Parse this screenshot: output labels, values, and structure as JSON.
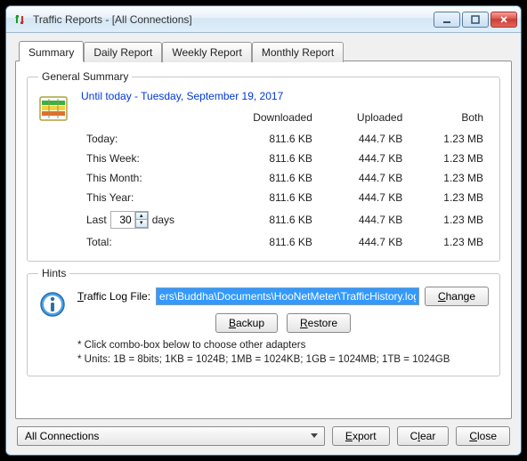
{
  "window": {
    "title": "Traffic Reports - [All Connections]"
  },
  "tabs": [
    "Summary",
    "Daily Report",
    "Weekly Report",
    "Monthly Report"
  ],
  "general": {
    "legend": "General Summary",
    "date_line": "Until today - Tuesday, September 19, 2017",
    "headers": [
      "",
      "Downloaded",
      "Uploaded",
      "Both"
    ],
    "rows": [
      {
        "label": "Today:",
        "down": "811.6 KB",
        "up": "444.7 KB",
        "both": "1.23 MB"
      },
      {
        "label": "This Week:",
        "down": "811.6 KB",
        "up": "444.7 KB",
        "both": "1.23 MB"
      },
      {
        "label": "This Month:",
        "down": "811.6 KB",
        "up": "444.7 KB",
        "both": "1.23 MB"
      },
      {
        "label": "This Year:",
        "down": "811.6 KB",
        "up": "444.7 KB",
        "both": "1.23 MB"
      }
    ],
    "last": {
      "prefix": "Last",
      "days_value": "30",
      "suffix": "days",
      "down": "811.6 KB",
      "up": "444.7 KB",
      "both": "1.23 MB"
    },
    "total": {
      "label": "Total:",
      "down": "811.6 KB",
      "up": "444.7 KB",
      "both": "1.23 MB"
    }
  },
  "hints": {
    "legend": "Hints",
    "log_label_pre": "T",
    "log_label_rest": "raffic Log File:",
    "log_value": "ers\\Buddha\\Documents\\HooNetMeter\\TrafficHistory.log",
    "change": "Change",
    "backup": "Backup",
    "restore": "Restore",
    "note1": "* Click combo-box below to choose other adapters",
    "note2": "* Units: 1B = 8bits; 1KB = 1024B; 1MB = 1024KB; 1GB = 1024MB; 1TB = 1024GB"
  },
  "bottom": {
    "adapter": "All Connections",
    "export": "Export",
    "clear": "Clear",
    "close": "Close"
  }
}
